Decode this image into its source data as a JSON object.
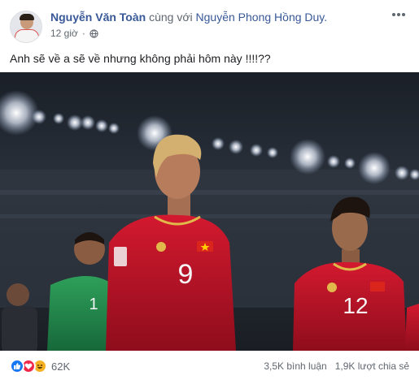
{
  "post": {
    "author": "Nguyễn Văn Toàn",
    "with_text": "cùng với",
    "tagged": "Nguyễn Phong Hồng Duy.",
    "time": "12 giờ",
    "privacy_icon": "globe-icon",
    "text": "Anh sẽ về a sẽ về nhưng không phải hôm này !!!!??"
  },
  "photo": {
    "player_numbers": [
      "9",
      "12",
      "1"
    ]
  },
  "footer": {
    "reaction_icons": [
      "like-icon",
      "love-icon",
      "haha-icon"
    ],
    "reaction_count": "62K",
    "comments": "3,5K bình luận",
    "shares": "1,9K lượt chia sẻ"
  },
  "colors": {
    "link": "#385898",
    "jersey_red": "#c8102e",
    "like": "#1877f2",
    "love": "#f0284a",
    "haha": "#f7b125"
  }
}
